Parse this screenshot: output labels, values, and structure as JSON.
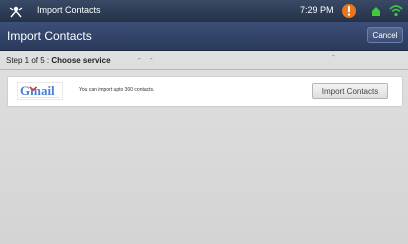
{
  "status_bar": {
    "app_title": "Import Contacts",
    "time": "7:29 PM",
    "icons": [
      "app-icon",
      "alert-icon",
      "notification-icon",
      "wifi-icon"
    ]
  },
  "action_bar": {
    "title": "Import Contacts",
    "cancel_label": "Cancel"
  },
  "step": {
    "prefix": "Step 1 of 5 : ",
    "name": "Choose service",
    "dashes": [
      "-",
      "-",
      "-"
    ]
  },
  "service": {
    "logo_text": "Gmail",
    "logo_icon": "gmail-logo",
    "description": "You can import upto 300 contacts.",
    "button_label": "Import Contacts"
  },
  "colors": {
    "status_bar": "#2f3d57",
    "action_bar": "#34466b",
    "background": "#d9d9d9",
    "alert_orange": "#e8761e",
    "wifi_green": "#3ec93e",
    "gmail_red": "#d4382b",
    "gmail_blue": "#4a7fd6"
  }
}
